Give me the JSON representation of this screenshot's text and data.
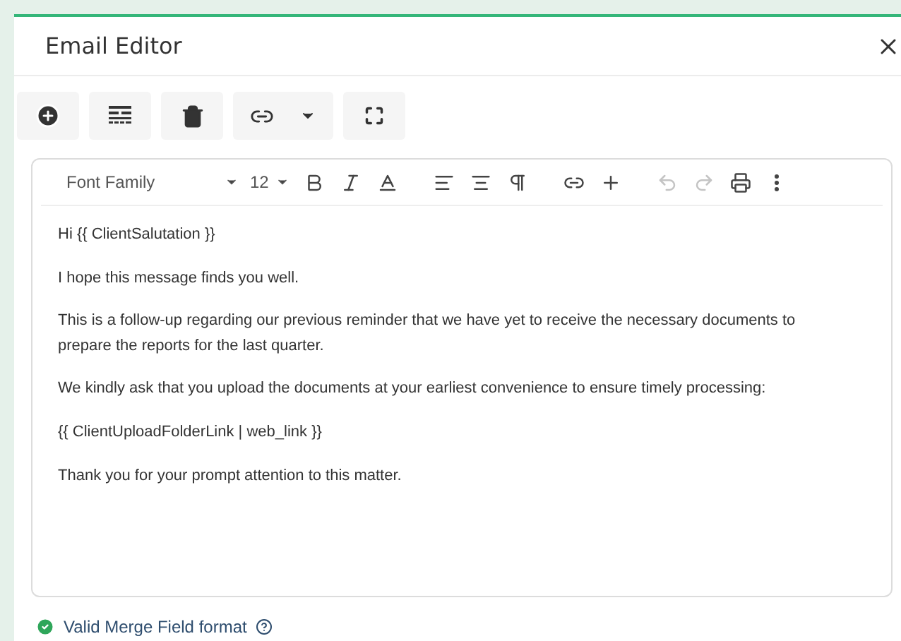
{
  "dialog": {
    "title": "Email Editor"
  },
  "toolbar": [
    {
      "kind": "add"
    },
    {
      "kind": "merge"
    },
    {
      "kind": "delete"
    },
    {
      "kind": "link"
    },
    {
      "kind": "fullscreen"
    }
  ],
  "editor_toolbar": {
    "font_family": "Font Family",
    "font_size": "12",
    "groups": [
      [
        {
          "kind": "bold",
          "disabled": false
        },
        {
          "kind": "italic",
          "disabled": false
        },
        {
          "kind": "fontsize",
          "disabled": false
        }
      ],
      [
        {
          "kind": "align-left",
          "disabled": false
        },
        {
          "kind": "align-center",
          "disabled": false
        },
        {
          "kind": "paragraph",
          "disabled": false
        }
      ],
      [
        {
          "kind": "link",
          "disabled": false
        },
        {
          "kind": "insert",
          "disabled": false
        }
      ],
      [
        {
          "kind": "undo",
          "disabled": true
        },
        {
          "kind": "redo",
          "disabled": true
        },
        {
          "kind": "print",
          "disabled": false
        },
        {
          "kind": "more",
          "disabled": false
        }
      ]
    ]
  },
  "body": [
    "Hi {{ ClientSalutation }}",
    "I hope this message finds you well.",
    "This is a follow-up regarding our previous reminder that we have yet to receive the necessary documents to prepare the reports for the last quarter.",
    "We kindly ask that you upload the documents at your earliest convenience to ensure timely processing:",
    "{{ ClientUploadFolderLink | web_link }}",
    "Thank you for your prompt attention to this matter."
  ],
  "validation": {
    "valid": true,
    "message": "Valid Merge Field format"
  }
}
